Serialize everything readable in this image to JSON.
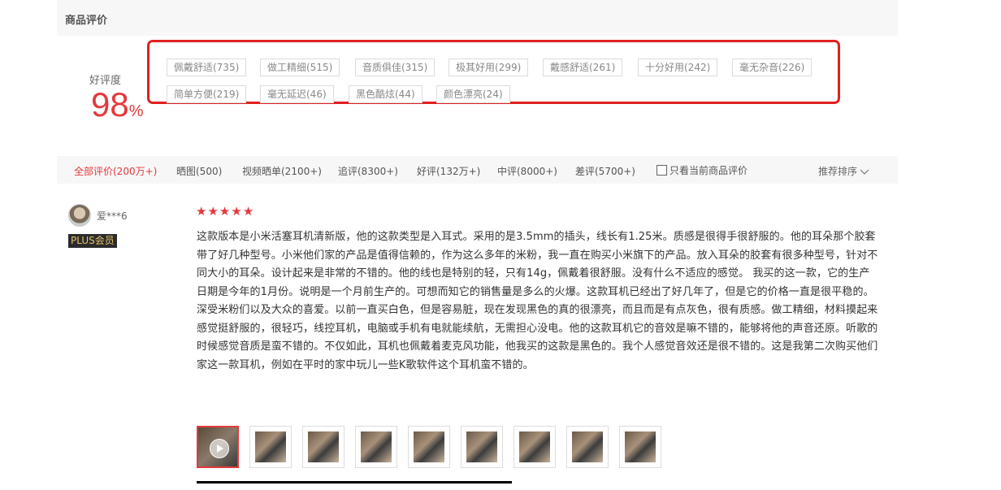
{
  "header": {
    "title": "商品评价"
  },
  "rating": {
    "label": "好评度",
    "value": "98",
    "unit": "%"
  },
  "tags": [
    "佩戴舒适(735)",
    "做工精细(515)",
    "音质俱佳(315)",
    "极其好用(299)",
    "戴感舒适(261)",
    "十分好用(242)",
    "毫无杂音(226)",
    "简单方便(219)",
    "毫无延迟(46)",
    "黑色酷炫(44)",
    "颜色漂亮(24)"
  ],
  "filters": {
    "tabs": [
      "全部评价(200万+)",
      "晒图(500)",
      "视频晒单(2100+)",
      "追评(8300+)",
      "好评(132万+)",
      "中评(8000+)",
      "差评(5700+)"
    ],
    "only_current_label": "只看当前商品评价",
    "sort_label": "推荐排序"
  },
  "review": {
    "username": "爱***6",
    "badge": "PLUS会员",
    "stars": 5,
    "text": "这款版本是小米活塞耳机清新版，他的这款类型是入耳式。采用的是3.5mm的插头，线长有1.25米。质感是很得手很舒服的。他的耳朵那个胶套带了好几种型号。小米他们家的产品是值得信赖的，作为这么多年的米粉，我一直在购买小米旗下的产品。放入耳朵的胶套有很多种型号，针对不同大小的耳朵。设计起来是非常的不错的。他的线也是特别的轻，只有14g，佩戴着很舒服。没有什么不适应的感觉。 我买的这一款，它的生产日期是今年的1月份。说明是一个月前生产的。可想而知它的销售量是多么的火爆。这款耳机已经出了好几年了，但是它的价格一直是很平稳的。深受米粉们以及大众的喜爱。以前一直买白色，但是容易脏，现在发现黑色的真的很漂亮，而且而是有点灰色，很有质感。做工精细，材料摸起来感觉挺舒服的，很轻巧，线控耳机，电脑或手机有电就能续航，无需担心没电。他的这款耳机它的音效是嘛不错的，能够将他的声音还原。听歌的时候感觉音质是蛮不错的。不仅如此，耳机也佩戴着麦克风功能，他我买的这款是黑色的。我个人感觉音效还是很不错的。这是我第二次购买他们家这一款耳机，例如在平时的家中玩儿一些K歌软件这个耳机蛮不错的。",
    "media_count": 9
  },
  "colors": {
    "accent": "#e4393c",
    "highlight_box": "#e02020",
    "badge_bg": "#2b2b2b",
    "badge_text": "#e8c46b"
  }
}
